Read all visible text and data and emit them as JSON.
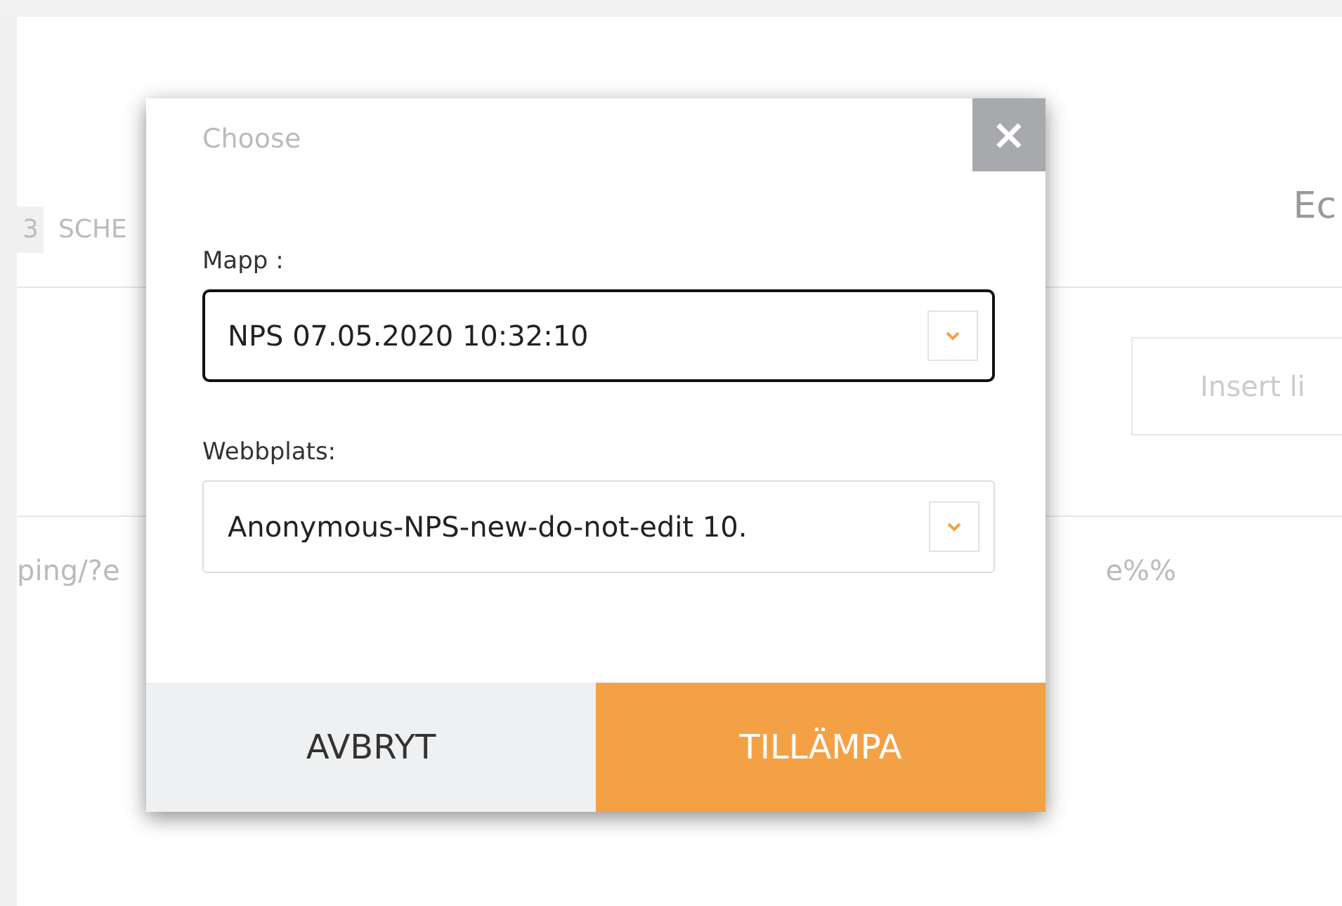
{
  "background": {
    "tab_fragment": "3",
    "tab_label": "SCHE",
    "header_right": "Ec",
    "insert_button": "Insert li",
    "url_left": "ping/?e",
    "url_right": "e%%"
  },
  "dialog": {
    "title": "Choose",
    "close": "×",
    "fields": [
      {
        "label": "Mapp :",
        "value": "NPS 07.05.2020 10:32:10",
        "focused": true
      },
      {
        "label": "Webbplats:",
        "value": "Anonymous-NPS-new-do-not-edit 10.",
        "focused": false
      }
    ],
    "buttons": [
      {
        "label": "AVBRYT",
        "kind": "cancel"
      },
      {
        "label": "TILLÄMPA",
        "kind": "primary"
      }
    ]
  }
}
